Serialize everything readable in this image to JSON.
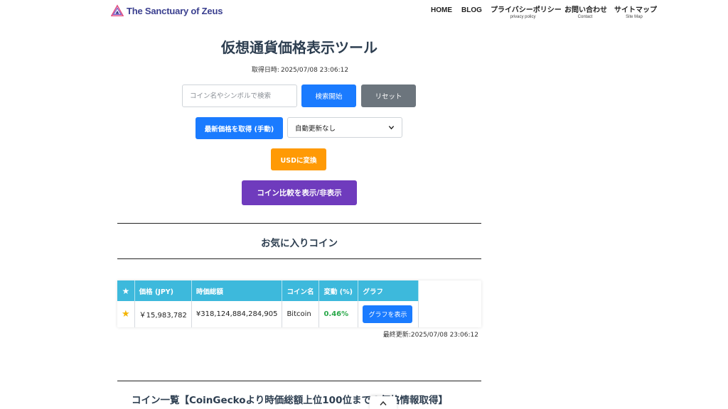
{
  "header": {
    "brand_name": "The Sanctuary of Zeus",
    "nav": [
      {
        "label": "HOME",
        "sub": ""
      },
      {
        "label": "BLOG",
        "sub": ""
      },
      {
        "label": "プライバシーポリシー",
        "sub": "privacy policy"
      },
      {
        "label": "お問い合わせ",
        "sub": "Contact"
      },
      {
        "label": "サイトマップ",
        "sub": "Site Map"
      }
    ]
  },
  "main": {
    "title": "仮想通貨価格表示ツール",
    "fetched_label": "取得日時:",
    "fetched_time": "2025/07/08 23:06:12",
    "search_placeholder": "コイン名やシンボルで検索",
    "search_value": "",
    "search_button": "検索開始",
    "reset_button": "リセット",
    "fetch_button": "最新価格を取得 (手動)",
    "auto_update_selected": "自動更新なし",
    "usd_button": "USDに変換",
    "compare_button": "コイン比較を表示/非表示"
  },
  "favorites": {
    "title": "お気に入りコイン",
    "columns": [
      "★",
      "価格 (JPY)",
      "時価総額",
      "コイン名",
      "変動 (%)",
      "グラフ"
    ],
    "rows": [
      {
        "star": "★",
        "price": "￥15,983,782",
        "market_cap": "¥318,124,884,284,905",
        "name": "Bitcoin",
        "change": "0.46%",
        "graph_button": "グラフを表示"
      }
    ],
    "updated_label": "最終更新:",
    "updated_time": "2025/07/08 23:06:12"
  },
  "coin_list": {
    "title": "コイン一覧【CoinGeckoより時価総額上位100位までの価格情報取得】"
  },
  "colors": {
    "primary": "#1a7bff",
    "secondary": "#6c757d",
    "warning": "#ff9a05",
    "purple": "#6f3bbd",
    "table_header": "#3db9dc",
    "positive": "#2aa84a",
    "star": "#f4b400"
  },
  "icons": {
    "logo": "triangle-logo-icon",
    "select": "chevron-down-icon",
    "scroll": "chevron-up-icon"
  }
}
